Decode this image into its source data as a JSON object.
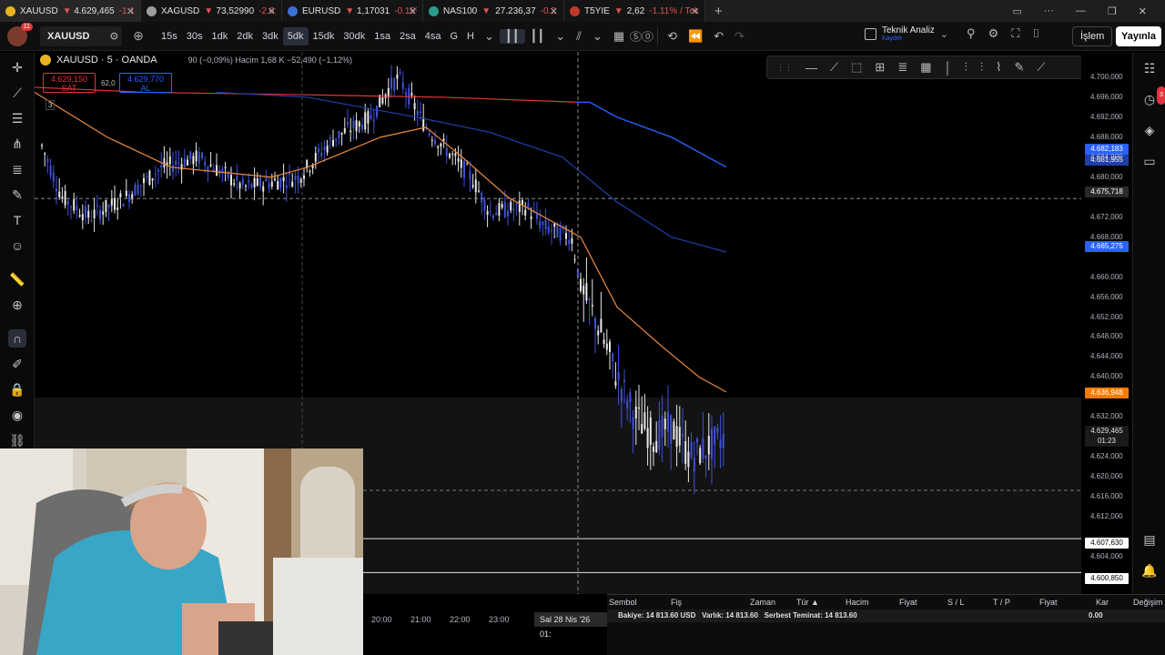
{
  "tabs": [
    {
      "symbol": "XAUUSD",
      "arrow": "▼",
      "value": "4.629,465",
      "change": "-1.12",
      "color": "#e8b520",
      "active": true
    },
    {
      "symbol": "XAGUSD",
      "arrow": "▼",
      "value": "73,52990",
      "change": "-2.61",
      "color": "#9e9e9e",
      "active": false
    },
    {
      "symbol": "EURUSD",
      "arrow": "▼",
      "value": "1,17031",
      "change": "-0.15%",
      "color": "#3b6fd4",
      "active": false
    },
    {
      "symbol": "NAS100",
      "arrow": "▼",
      "value": "27.236,37",
      "change": "-0.2",
      "color": "#2a9d8f",
      "active": false
    },
    {
      "symbol": "T5YIE",
      "arrow": "▼",
      "value": "2,62",
      "change": "-1.11% / Tekn",
      "color": "#c0392b",
      "active": false
    }
  ],
  "toolbar": {
    "avatar_badge": "11",
    "symbol": "XAUUSD",
    "intervals": [
      "15s",
      "30s",
      "1dk",
      "2dk",
      "3dk",
      "5dk",
      "15dk",
      "30dk",
      "1sa",
      "2sa",
      "4sa",
      "G",
      "H"
    ],
    "active_interval": "5dk",
    "counter_a": "5",
    "counter_b": "0",
    "ta_title": "Teknik Analiz",
    "ta_sub": "Kaydet",
    "islem": "İşlem",
    "yayinla": "Yayınla"
  },
  "legend": {
    "title": "XAUUSD · 5 · OANDA",
    "info": "90 (−0,09%)  Hacim 1,68 K  −52,490 (−1,12%)",
    "sell_price": "4.629,150",
    "sell_label": "SAT",
    "buy_price": "4.629,770",
    "buy_label": "AL",
    "spread": "62,0",
    "collapsed_count": "3"
  },
  "price_axis": {
    "labels": [
      "4.700,000",
      "4.696,000",
      "4.692,000",
      "4.688,000",
      "4.684,000",
      "4.680,000",
      "4.672,000",
      "4.668,000",
      "4.660,000",
      "4.656,000",
      "4.652,000",
      "4.648,000",
      "4.644,000",
      "4.640,000",
      "4.632,000",
      "4.624,000",
      "4.620,000",
      "4.616,000",
      "4.612,000",
      "4.604,000"
    ],
    "tag_blue1": "4.682,183",
    "tag_blue2": "4.681,955",
    "tag_crosshair": "4.675,718",
    "tag_blue3": "4.665,275",
    "tag_orange": "4.636,948",
    "tag_last": "4.629,465",
    "tag_countdown": "01:23",
    "tag_line1": "4.607,630",
    "tag_line2": "4.600,850",
    "colors": {
      "blue": "#2962ff",
      "orange": "#f57c00",
      "last": "#1a1a1a"
    }
  },
  "time_axis": {
    "labels": [
      "20:00",
      "21:00",
      "22:00",
      "23:00"
    ],
    "crosshair": "Sal 28 Nis '26",
    "crosshair_time": "01:"
  },
  "panel": {
    "headers": [
      "Sembol",
      "Fiş",
      "Zaman",
      "Tür ▲",
      "Hacim",
      "Fiyat",
      "S / L",
      "T / P",
      "Fiyat",
      "Kar",
      "Değişim"
    ],
    "balance": "Bakiye: 14 813.60 USD",
    "equity": "Varlık: 14 813.60",
    "free_margin": "Serbest Teminat: 14 813.60",
    "profit": "0.00"
  },
  "chart_data": {
    "type": "candlestick",
    "symbol": "XAUUSD",
    "timeframe": "5",
    "ylim": [
      4600,
      4702
    ],
    "moving_averages": [
      {
        "color": "#e53935"
      },
      {
        "color": "#ef8a3c"
      },
      {
        "color": "#1f3fa8"
      },
      {
        "color": "#2962ff"
      }
    ],
    "horizontal_lines": [
      4607.63,
      4600.85
    ],
    "crosshair_price": 4675.718
  }
}
